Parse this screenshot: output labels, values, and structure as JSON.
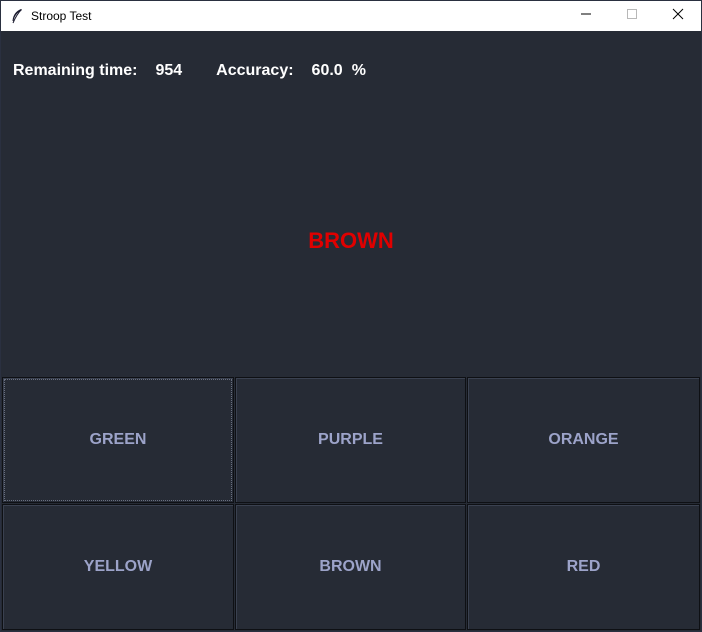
{
  "window": {
    "title": "Stroop Test",
    "app_icon": "feather-icon",
    "controls": [
      "minimize-icon",
      "maximize-icon",
      "close-icon"
    ]
  },
  "status": {
    "time_label": "Remaining time:",
    "time_value": "954",
    "accuracy_label": "Accuracy:",
    "accuracy_value": "60.0",
    "accuracy_unit": "%"
  },
  "stimulus": {
    "word": "BROWN",
    "ink_color": "#e00000"
  },
  "choices": [
    {
      "label": "GREEN"
    },
    {
      "label": "PURPLE"
    },
    {
      "label": "ORANGE"
    },
    {
      "label": "YELLOW"
    },
    {
      "label": "BROWN"
    },
    {
      "label": "RED"
    }
  ],
  "colors": {
    "background": "#262b35",
    "choice_text": "#9ca3c9",
    "status_text": "#ffffff"
  }
}
